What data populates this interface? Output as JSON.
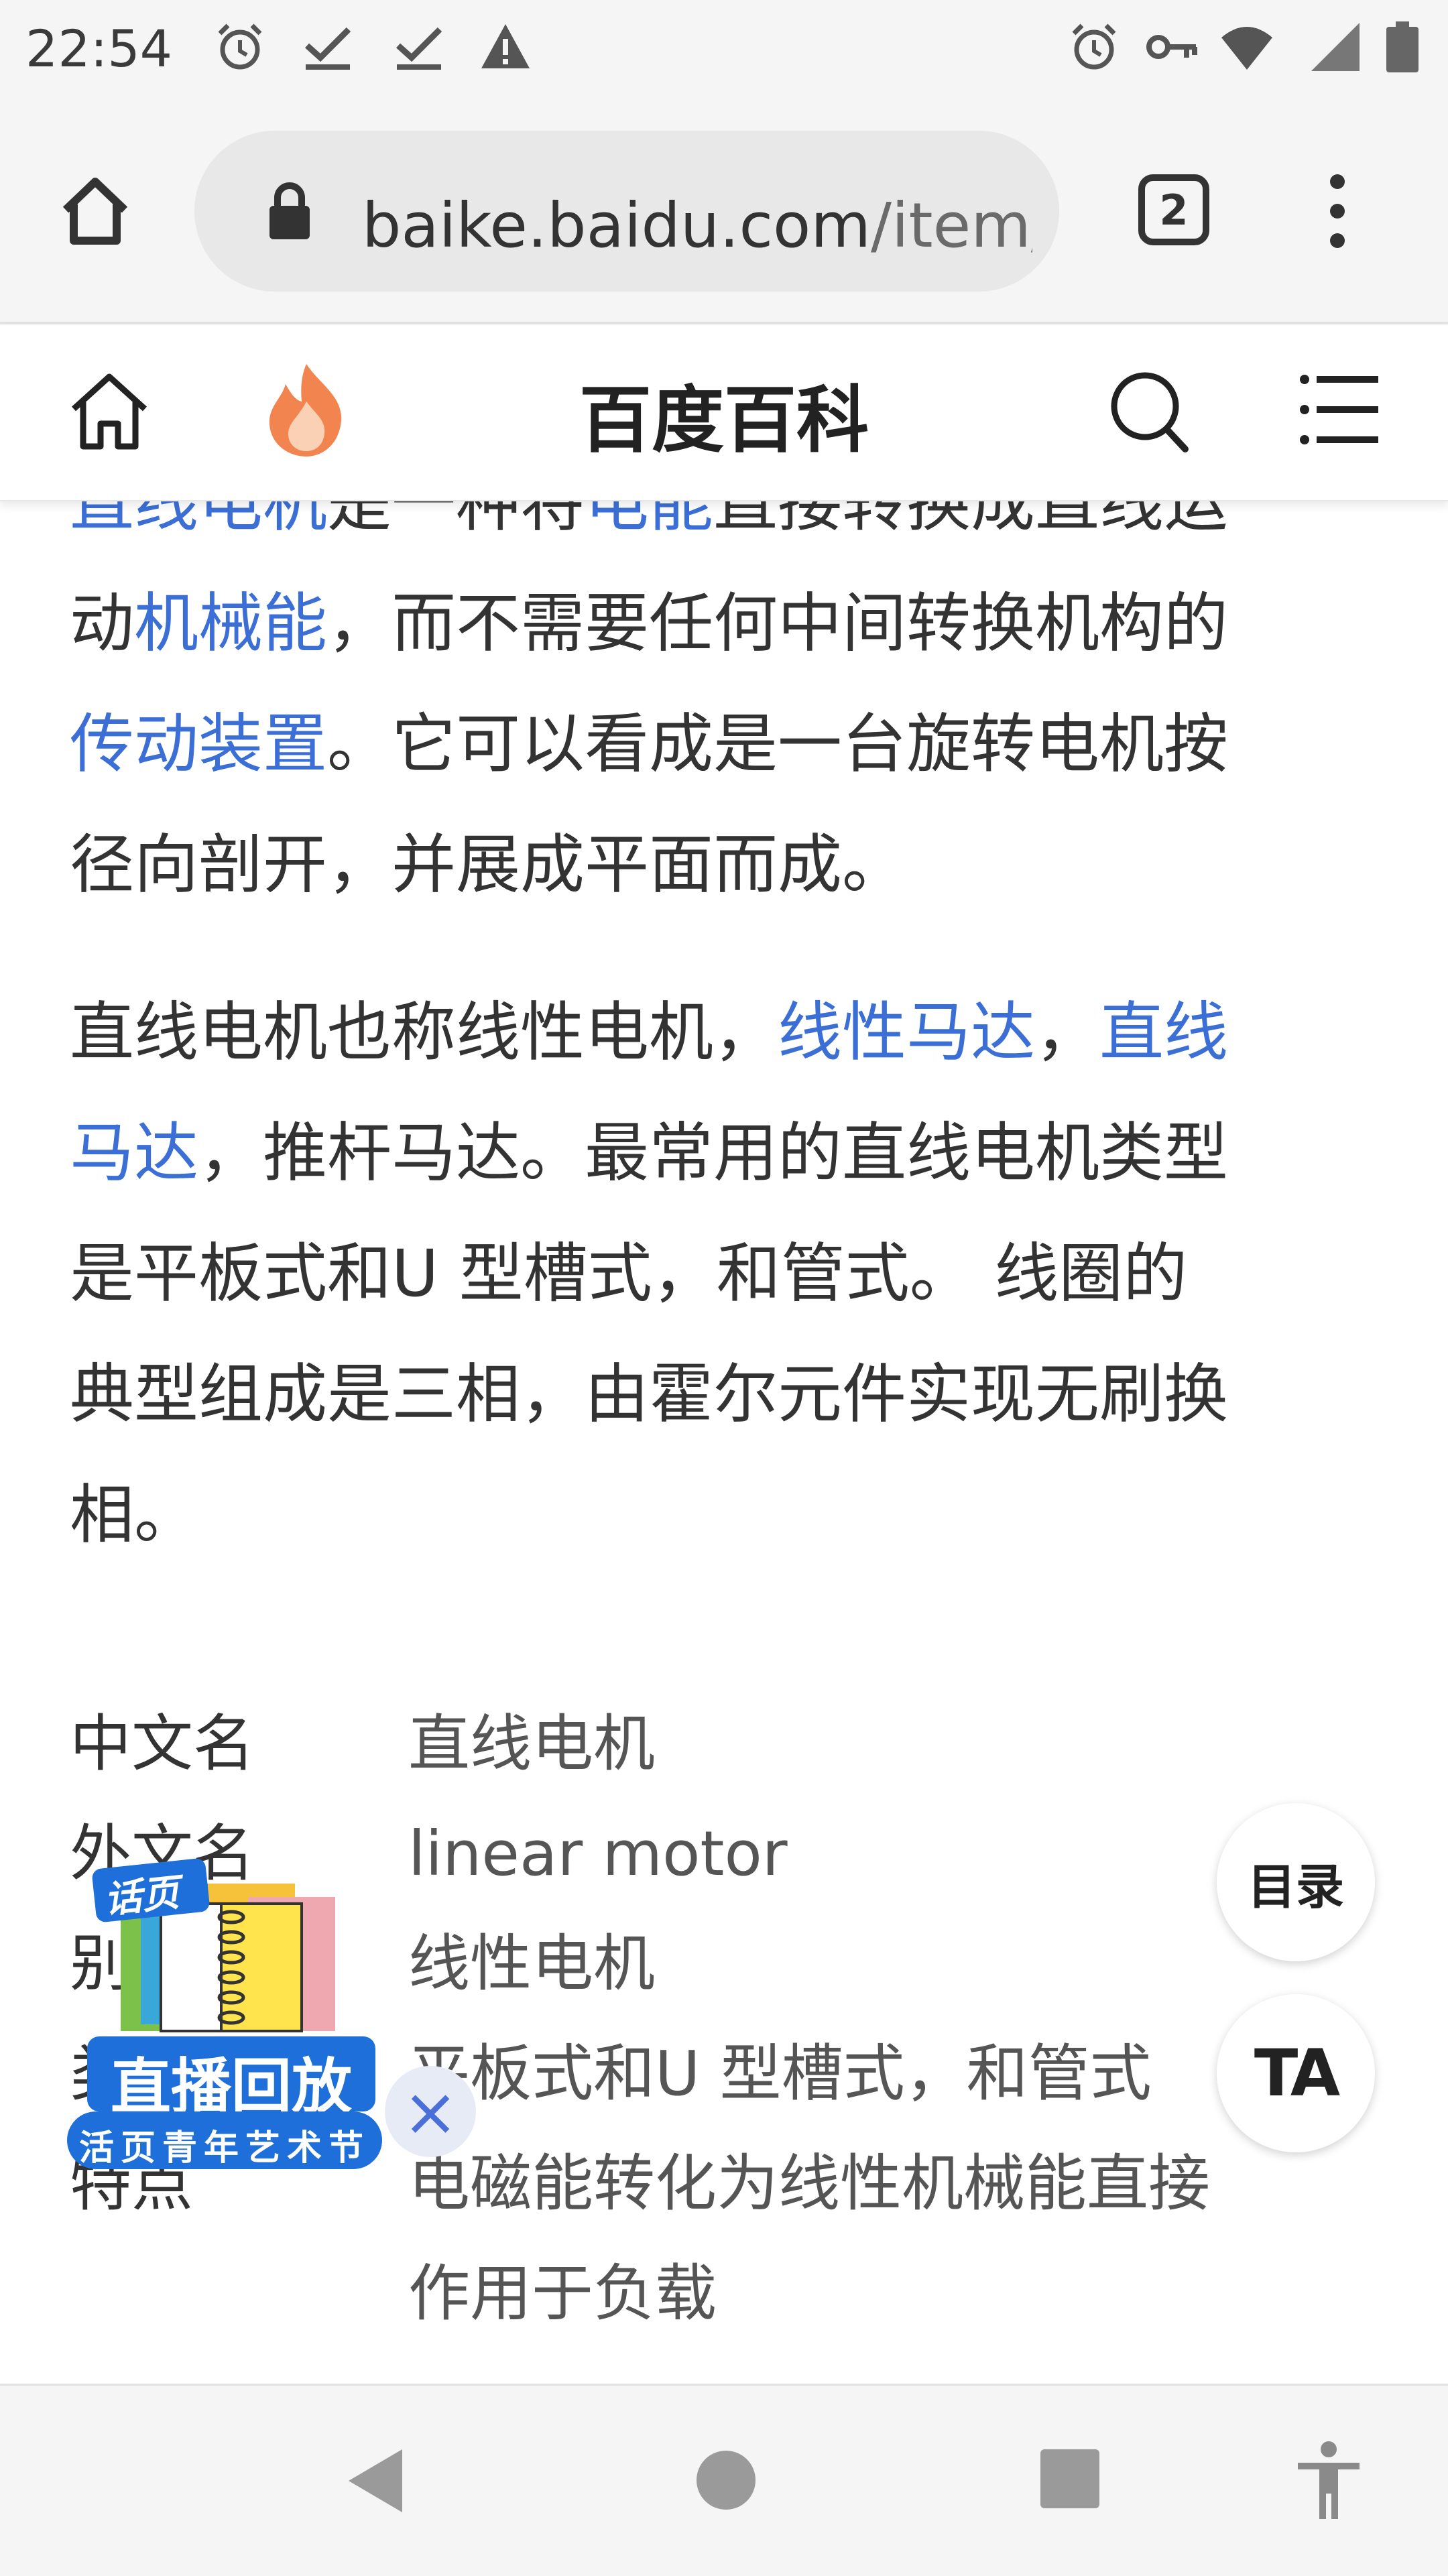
{
  "status_bar": {
    "time": "22:54",
    "left_icons": [
      "alarm-icon",
      "check-icon",
      "check-icon",
      "warning-icon"
    ],
    "right_icons": [
      "alarm-icon",
      "vpn-key-icon",
      "wifi-icon",
      "signal-icon",
      "battery-icon"
    ]
  },
  "browser": {
    "url_domain": "baike.baidu.com",
    "url_rest": "/item/直线电机",
    "tab_count": "2",
    "icons": [
      "home-icon",
      "lock-icon",
      "menu-dots-icon"
    ]
  },
  "site": {
    "title": "百度百科",
    "icons": [
      "home-outline-icon",
      "flame-icon",
      "search-icon",
      "menu-lines-icon"
    ]
  },
  "article": {
    "para1": {
      "line0": [
        {
          "t": "直线电机",
          "link": true
        },
        {
          "t": "是一种将",
          "link": false
        },
        {
          "t": "电能",
          "link": true
        },
        {
          "t": "直接转换成直线运",
          "link": false
        }
      ],
      "line1": [
        {
          "t": "动",
          "link": false
        },
        {
          "t": "机械能",
          "link": true
        },
        {
          "t": "，而不需要任何中间转换机构的",
          "link": false
        }
      ],
      "line2": [
        {
          "t": "传动装置",
          "link": true
        },
        {
          "t": "。它可以看成是一台旋转电机按",
          "link": false
        }
      ],
      "line3": [
        {
          "t": "径向剖开，并展成平面而成。",
          "link": false
        }
      ]
    },
    "para2": {
      "line0": [
        {
          "t": "直线电机也称线性电机，",
          "link": false
        },
        {
          "t": "线性马达",
          "link": true
        },
        {
          "t": "，",
          "link": false
        },
        {
          "t": "直线",
          "link": true
        }
      ],
      "line1": [
        {
          "t": "马达",
          "link": true
        },
        {
          "t": "，推杆马达。最常用的直线电机类型",
          "link": false
        }
      ],
      "line2": [
        {
          "t": "是平板式和U 型槽式，和管式。 线圈的",
          "link": false
        }
      ],
      "line3": [
        {
          "t": "典型组成是三相，由霍尔元件实现无刷换",
          "link": false
        }
      ],
      "line4": [
        {
          "t": "相。",
          "link": false
        }
      ]
    }
  },
  "infobox": [
    {
      "k": "中文名",
      "v": "直线电机"
    },
    {
      "k": "外文名",
      "v": "linear motor"
    },
    {
      "k": "别名",
      "v": "线性电机"
    },
    {
      "k": "类型",
      "v": "平板式和U 型槽式，和管式"
    },
    {
      "k": "特点",
      "v": "电磁能转化为线性机械能直接",
      "v2": "作用于负载"
    }
  ],
  "floating": {
    "toc_label": "目录",
    "text_size_label": "TA",
    "ad": {
      "badge": "话页",
      "title": "直播回放",
      "subtitle": "活页青年艺术节",
      "close": "×"
    }
  },
  "nav": {
    "icons": [
      "back-icon",
      "home-circle-icon",
      "recents-icon",
      "accessibility-icon"
    ]
  },
  "colors": {
    "link": "#3b6fd6",
    "ad_blue": "#1e6fd9"
  }
}
